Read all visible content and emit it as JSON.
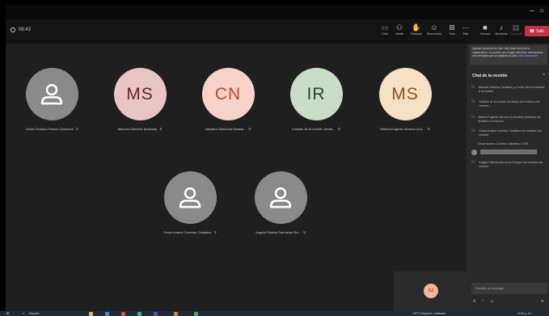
{
  "window": {
    "minimize": "–",
    "close": "○"
  },
  "toolbar": {
    "timer": "06:43",
    "items": [
      {
        "label": "Chat",
        "icon": "chat-icon"
      },
      {
        "label": "Gente",
        "icon": "people-icon"
      },
      {
        "label": "Participar",
        "icon": "raise-hand-icon"
      },
      {
        "label": "Reacciones",
        "icon": "smile-icon"
      },
      {
        "label": "Vista",
        "icon": "view-icon"
      },
      {
        "label": "Más",
        "icon": "more-icon"
      },
      {
        "label": "Cámara",
        "icon": "camera-icon"
      },
      {
        "label": "Micrófono",
        "icon": "microphone-icon"
      },
      {
        "label": "Compartir",
        "icon": "share-icon"
      }
    ],
    "leave_label": "Salir"
  },
  "participants_row1": [
    {
      "initials": "",
      "name": "Carlos Gustavo Rincon Quinones",
      "bg": "#8a8a8a",
      "fg": "#ffffff"
    },
    {
      "initials": "MS",
      "name": "Marcela Sanchez (Invitado)",
      "bg": "#e8c4c4",
      "fg": "#6b1f2a"
    },
    {
      "initials": "CN",
      "name": "claudia's MainGoal Natalia...",
      "bg": "#f6d2c8",
      "fg": "#b44a2c"
    },
    {
      "initials": "IR",
      "name": "Invitado de la reunión (Invita...",
      "bg": "#c8dcc8",
      "fg": "#1e4b2a"
    },
    {
      "initials": "MS",
      "name": "Martha Eugenia Serrano (Col...",
      "bg": "#f7e1c4",
      "fg": "#8a5217"
    }
  ],
  "participants_row2": [
    {
      "initials": "",
      "name": "Cesar Andres Corredor Caballero",
      "bg": "#8a8a8a",
      "fg": "#ffffff"
    },
    {
      "initials": "",
      "name": "Angela Patricia Sarmiento Ro...",
      "bg": "#8a8a8a",
      "fg": "#ffffff"
    }
  ],
  "self_tile": {
    "initials": "SZ"
  },
  "chat": {
    "notice": "Algunas personas de este chat están fuera de tu organización. Es posible que tengas directivas relacionadas con mensajes que se apliquen al chat.",
    "notice_link": "Más información",
    "title": "Chat de la reunión",
    "messages": [
      "Marcela Sanchez (Invitado) y 2 más fueron invitados a la reunión.",
      "Invitado de la reunión (Invitado) fue invitado a la reunión.",
      "Martha Eugenia Serrano (Colombia) (Invitado) fue invitado a la reunión.",
      "Cesar Andres Corredor Caballero fue invitado a la reunión.",
      "Cesar Andres Corredor Caballero 14:08",
      "Angela Patricia Sarmiento Robayo fue invitado a la reunión."
    ],
    "compose_placeholder": "Escribir un mensaje"
  },
  "taskbar": {
    "search": "Buscar",
    "weather": "18°C Mayorm. nublado",
    "time": "4:26 p. m."
  }
}
